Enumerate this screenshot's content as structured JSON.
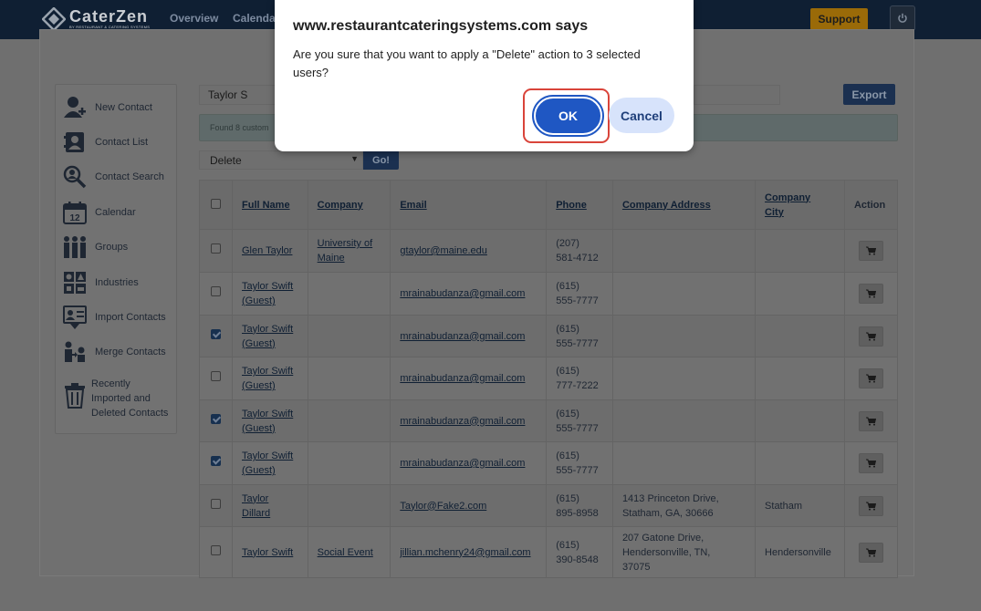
{
  "app": {
    "logo_name": "CaterZen",
    "logo_tagline": "BY RESTAURANT & CATERING SYSTEMS"
  },
  "nav": {
    "items": [
      "Overview",
      "Calendar"
    ],
    "support_label": "Support"
  },
  "sidebar": {
    "items": [
      {
        "label": "New Contact",
        "icon": "add-contact-icon"
      },
      {
        "label": "Contact List",
        "icon": "contact-list-icon"
      },
      {
        "label": "Contact Search",
        "icon": "search-icon"
      },
      {
        "label": "Calendar",
        "icon": "calendar-icon",
        "icon_text": "12"
      },
      {
        "label": "Groups",
        "icon": "groups-icon"
      },
      {
        "label": "Industries",
        "icon": "industries-icon"
      },
      {
        "label": "Import Contacts",
        "icon": "import-icon"
      },
      {
        "label": "Merge Contacts",
        "icon": "merge-icon"
      },
      {
        "label": "Recently Imported and Deleted Contacts",
        "icon": "trash-icon",
        "lines": [
          "Recently",
          "Imported and",
          "Deleted Contacts"
        ]
      }
    ]
  },
  "search": {
    "value": "Taylor S"
  },
  "export_label": "Export",
  "found_text": "Found 8 custom",
  "bulk_action": {
    "selected": "Delete",
    "go_label": "Go!"
  },
  "table": {
    "headers": {
      "full_name": "Full Name",
      "company": "Company",
      "email": "Email",
      "phone": "Phone",
      "company_address": "Company Address",
      "company_city_1": "Company",
      "company_city_2": "City",
      "action": "Action"
    },
    "rows": [
      {
        "checked": false,
        "name": [
          "Glen Taylor"
        ],
        "company": [
          "University of",
          "Maine"
        ],
        "email": "gtaylor@maine.edu",
        "phone": [
          "(207)",
          "581-4712"
        ],
        "address": [],
        "city": ""
      },
      {
        "checked": false,
        "name": [
          "Taylor Swift",
          "(Guest)"
        ],
        "company": [],
        "email": "mrainabudanza@gmail.com",
        "phone": [
          "(615)",
          "555-7777"
        ],
        "address": [],
        "city": ""
      },
      {
        "checked": true,
        "name": [
          "Taylor Swift",
          "(Guest)"
        ],
        "company": [],
        "email": "mrainabudanza@gmail.com",
        "phone": [
          "(615)",
          "555-7777"
        ],
        "address": [],
        "city": ""
      },
      {
        "checked": false,
        "name": [
          "Taylor Swift",
          "(Guest)"
        ],
        "company": [],
        "email": "mrainabudanza@gmail.com",
        "phone": [
          "(615)",
          "777-7222"
        ],
        "address": [],
        "city": ""
      },
      {
        "checked": true,
        "name": [
          "Taylor Swift",
          "(Guest)"
        ],
        "company": [],
        "email": "mrainabudanza@gmail.com",
        "phone": [
          "(615)",
          "555-7777"
        ],
        "address": [],
        "city": ""
      },
      {
        "checked": true,
        "name": [
          "Taylor Swift",
          "(Guest)"
        ],
        "company": [],
        "email": "mrainabudanza@gmail.com",
        "phone": [
          "(615)",
          "555-7777"
        ],
        "address": [],
        "city": ""
      },
      {
        "checked": false,
        "name": [
          "Taylor",
          "Dillard"
        ],
        "company": [],
        "email": "Taylor@Fake2.com",
        "phone": [
          "(615)",
          "895-8958"
        ],
        "address": [
          "1413 Princeton Drive,",
          "Statham, GA, 30666"
        ],
        "city": "Statham"
      },
      {
        "checked": false,
        "name": [
          "Taylor Swift"
        ],
        "company": [
          "Social Event"
        ],
        "email": "jillian.mchenry24@gmail.com",
        "phone": [
          "(615)",
          "390-8548"
        ],
        "address": [
          "207 Gatone Drive,",
          "Hendersonville, TN,",
          "37075"
        ],
        "city": "Hendersonville"
      }
    ]
  },
  "dialog": {
    "title": "www.restaurantcateringsystems.com says",
    "message": "Are you sure that you want to apply a \"Delete\" action to 3 selected users?",
    "ok_label": "OK",
    "cancel_label": "Cancel"
  },
  "colors": {
    "ok_button": "#1f57c3",
    "highlight_ring": "#d9443a",
    "support_button": "#9a6a08"
  }
}
